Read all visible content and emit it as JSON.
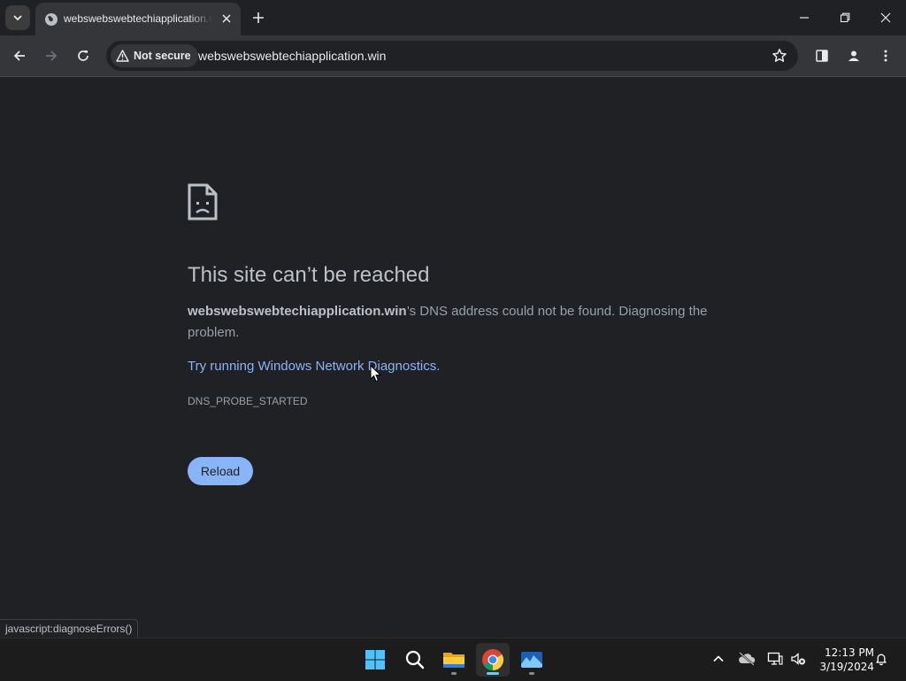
{
  "browser": {
    "tab": {
      "title": "webswebswebtechiapplication.win",
      "favicon": "globe-icon"
    },
    "toolbar": {
      "security_label": "Not secure",
      "url": "webswebswebtechiapplication.win"
    }
  },
  "page": {
    "heading": "This site can’t be reached",
    "description_domain": "webswebswebtechiapplication.win",
    "description_rest": "’s DNS address could not be found. Diagnosing the problem.",
    "diagnostics_link": "Try running Windows Network Diagnostics.",
    "error_code": "DNS_PROBE_STARTED",
    "reload_label": "Reload"
  },
  "status_bar": {
    "text": "javascript:diagnoseErrors()"
  },
  "taskbar": {
    "apps": [
      "start-icon",
      "search-icon",
      "file-explorer-icon",
      "chrome-icon",
      "photos-icon"
    ],
    "clock": {
      "time": "12:13 PM",
      "date": "3/19/2024"
    }
  },
  "colors": {
    "background": "#202124",
    "link": "#8ab4f8",
    "button": "#8ab4f8",
    "taskbar_accent": "#60cdff"
  }
}
